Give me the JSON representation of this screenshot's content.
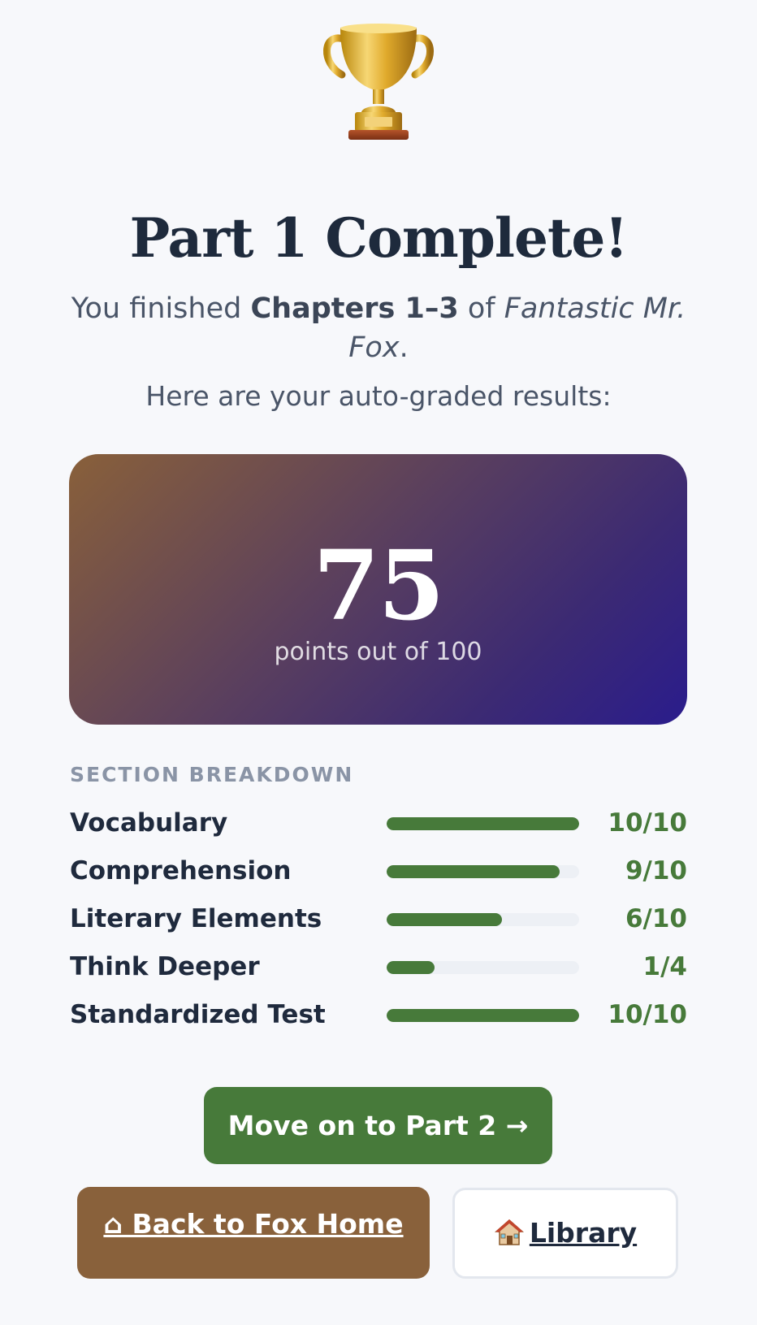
{
  "header": {
    "trophy_icon": "trophy-icon",
    "title": "Part 1 Complete!",
    "subtitle_prefix": "You finished ",
    "subtitle_chapters": "Chapters 1–3",
    "subtitle_middle": " of ",
    "subtitle_book": "Fantastic Mr. Fox",
    "subtitle_suffix": ".",
    "lead": "Here are your auto-graded results:"
  },
  "score": {
    "value": "75",
    "caption": "points out of 100"
  },
  "breakdown": {
    "heading": "SECTION BREAKDOWN",
    "sections": [
      {
        "label": "Vocabulary",
        "score": "10/10",
        "fraction": 1.0
      },
      {
        "label": "Comprehension",
        "score": "9/10",
        "fraction": 0.9
      },
      {
        "label": "Literary Elements",
        "score": "6/10",
        "fraction": 0.6
      },
      {
        "label": "Think Deeper",
        "score": "1/4",
        "fraction": 0.25
      },
      {
        "label": "Standardized Test",
        "score": "10/10",
        "fraction": 1.0
      }
    ],
    "bar_color": "#477a3a",
    "track_color": "#edf0f5"
  },
  "actions": {
    "next_label": "Move on to Part 2 →",
    "home_label": "⌂ Back to Fox Home",
    "library_label": "Library",
    "library_icon": "house-icon"
  },
  "colors": {
    "accent_green": "#477a3a",
    "accent_brown": "#89613b",
    "score_gradient_start": "#89603a",
    "score_gradient_end": "#2a1c8c"
  }
}
